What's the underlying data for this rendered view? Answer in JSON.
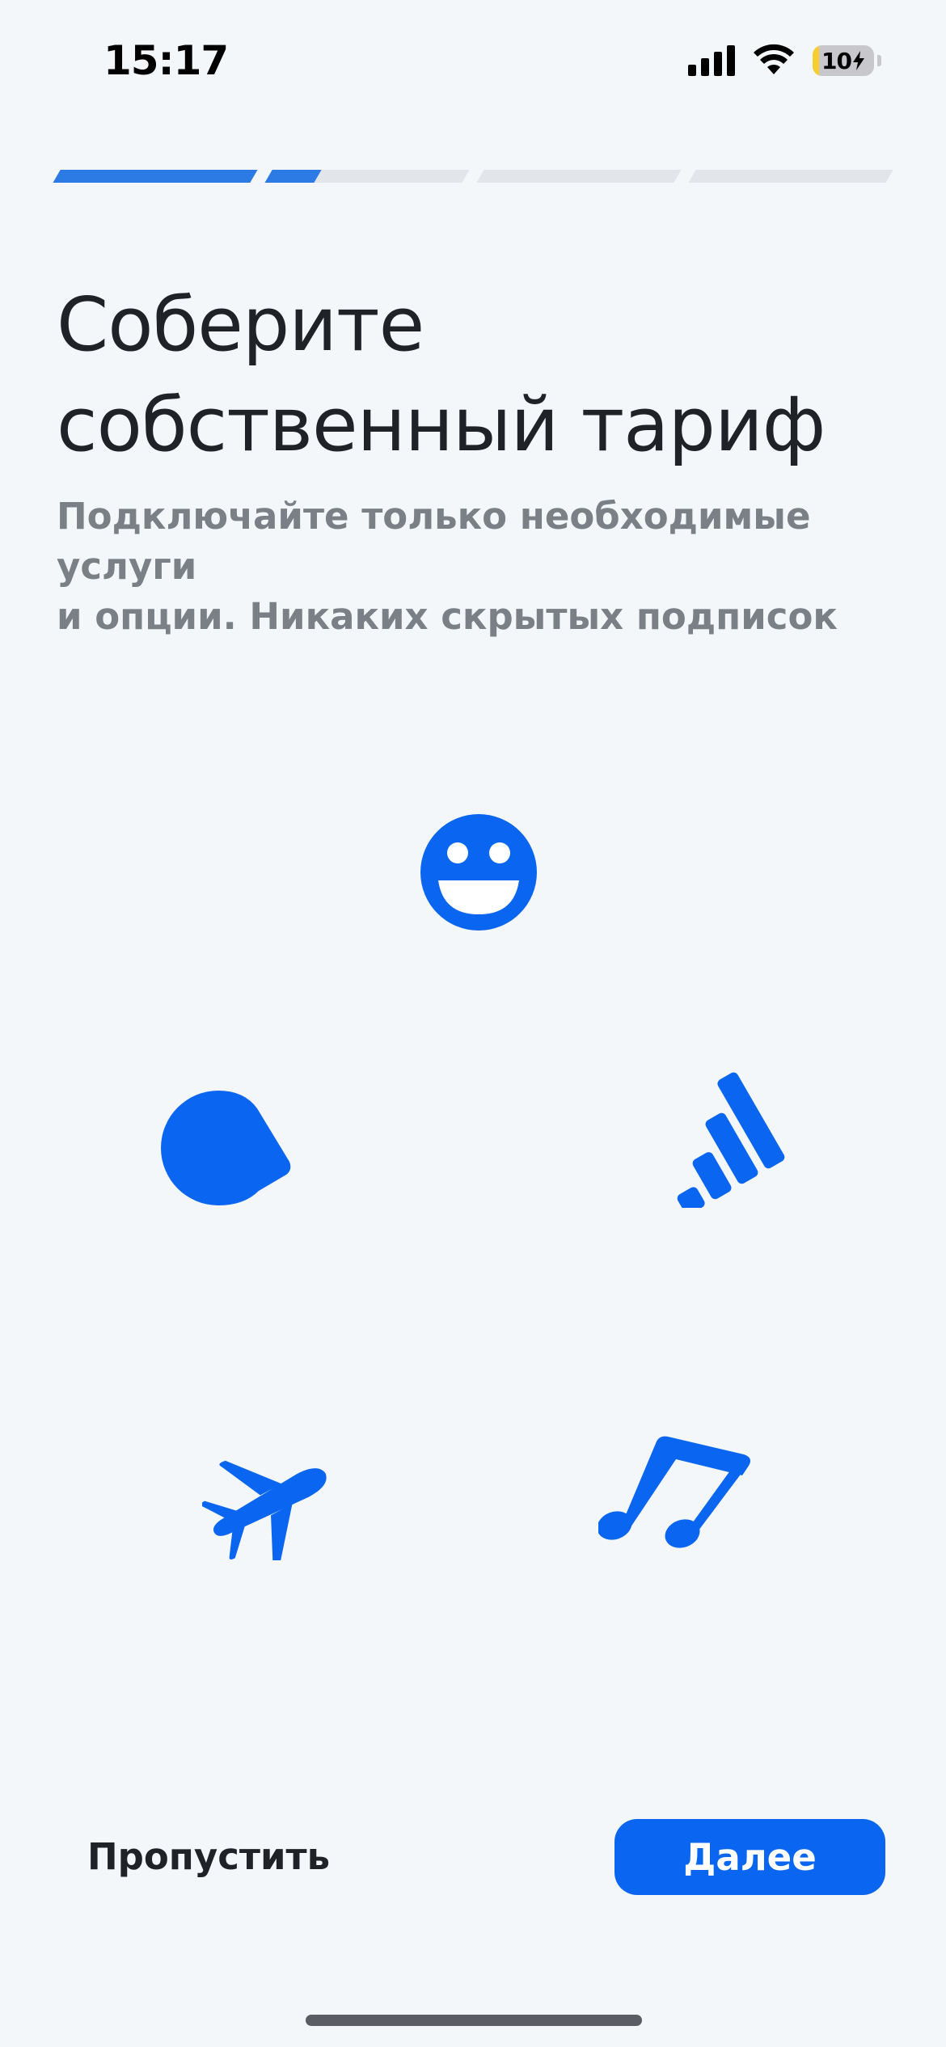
{
  "status_bar": {
    "time": "15:17",
    "battery_level": "10",
    "battery_fraction": 0.1,
    "icons": [
      "cellular-signal-icon",
      "wifi-icon",
      "battery-charging-icon"
    ]
  },
  "progress": {
    "segments": 4,
    "fill": [
      1.0,
      0.25,
      0.0,
      0.0
    ],
    "active_color": "#2c7be5",
    "inactive_color": "#e2e5ea"
  },
  "onboarding": {
    "title_line1": "Соберите",
    "title_line2": "собственный тариф",
    "subtitle_line1": "Подключайте только необходимые услуги",
    "subtitle_line2": "и опции. Никаких скрытых подписок"
  },
  "illustration": {
    "icons": [
      "smile-icon",
      "chat-bubble-icon",
      "signal-bars-icon",
      "airplane-icon",
      "music-note-icon"
    ],
    "color": "#0a66f0"
  },
  "actions": {
    "skip_label": "Пропустить",
    "next_label": "Далее",
    "primary_color": "#0a66f0"
  }
}
